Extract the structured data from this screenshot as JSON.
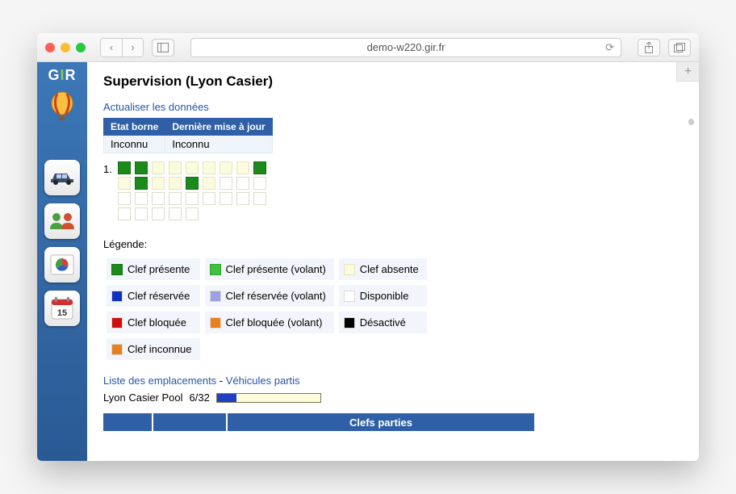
{
  "browser": {
    "url": "demo-w220.gir.fr"
  },
  "sidebar": {
    "logo": "GIR"
  },
  "page": {
    "title": "Supervision (Lyon Casier)",
    "refresh_link": "Actualiser les données",
    "state_header_1": "Etat borne",
    "state_header_2": "Dernière mise à jour",
    "state_value_1": "Inconnu",
    "state_value_2": "Inconnu",
    "grid_label": "1.",
    "slots": [
      "green",
      "green",
      "ivory",
      "ivory",
      "ivory",
      "ivory",
      "ivory",
      "ivory",
      "green",
      "ivory",
      "green",
      "ivory",
      "ivory",
      "green",
      "ivory",
      "white",
      "white",
      "white",
      "white",
      "white",
      "white",
      "white",
      "white",
      "white",
      "white",
      "white",
      "white",
      "white",
      "white",
      "white",
      "white",
      "white"
    ],
    "legend_title": "Légende:",
    "legend": [
      [
        {
          "swatch": "green",
          "label": "Clef présente"
        },
        {
          "swatch": "lightgreen",
          "label": "Clef présente (volant)"
        },
        {
          "swatch": "ivory",
          "label": "Clef absente"
        }
      ],
      [
        {
          "swatch": "blue",
          "label": "Clef réservée"
        },
        {
          "swatch": "lilac",
          "label": "Clef réservée (volant)"
        },
        {
          "swatch": "white",
          "label": "Disponible"
        }
      ],
      [
        {
          "swatch": "red",
          "label": "Clef bloquée"
        },
        {
          "swatch": "orange",
          "label": "Clef bloquée (volant)"
        },
        {
          "swatch": "black",
          "label": "Désactivé"
        }
      ],
      [
        {
          "swatch": "orange",
          "label": "Clef inconnue"
        }
      ]
    ],
    "list_link_1": "Liste des emplacements",
    "list_sep": " - ",
    "list_link_2": "Véhicules partis",
    "pool_name": "Lyon Casier Pool",
    "pool_count": "6/32",
    "pool_fill_percent": 18.75,
    "bottom_header": "Clefs parties"
  }
}
